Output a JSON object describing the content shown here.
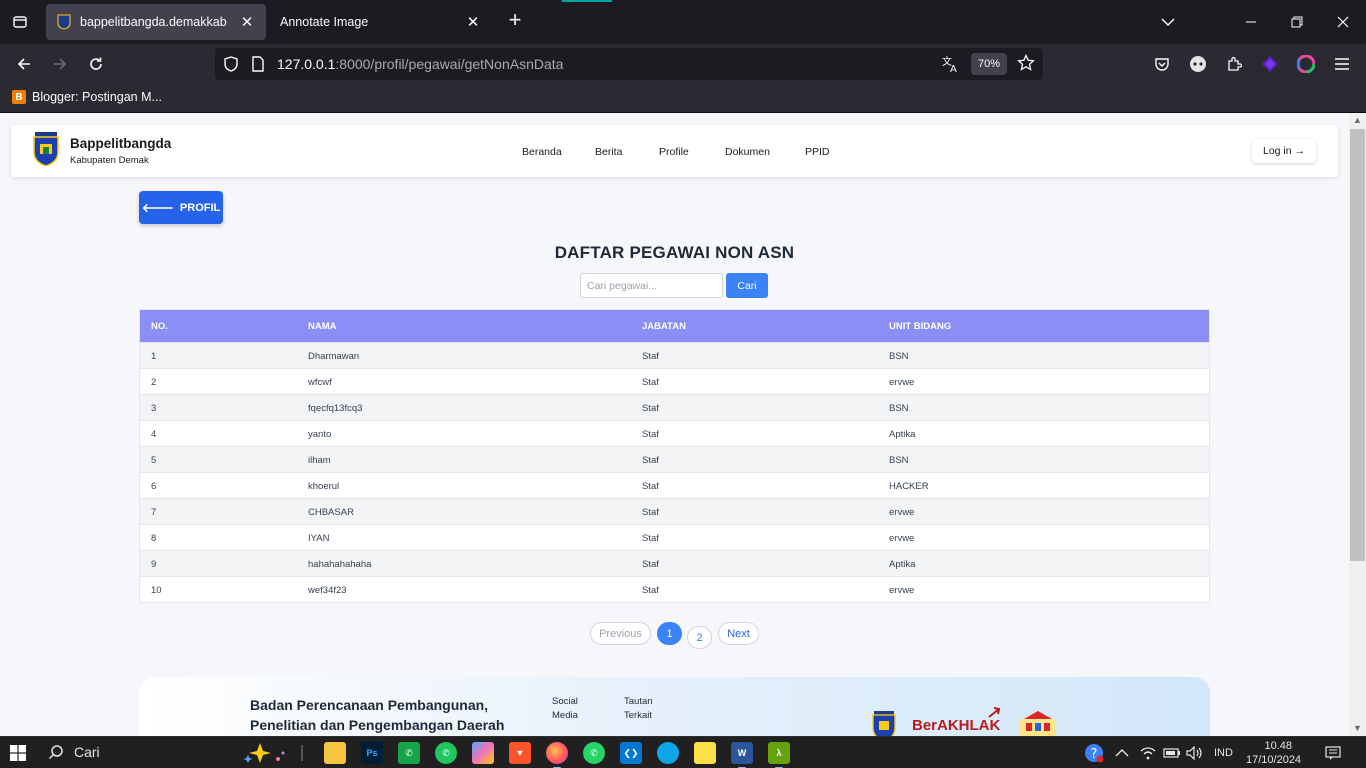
{
  "browser": {
    "tabs": [
      {
        "title": "bappelitbangda.demakkab",
        "active": true
      },
      {
        "title": "Annotate Image",
        "active": false
      }
    ],
    "url_host": "127.0.0.1",
    "url_rest": ":8000/profil/pegawai/getNonAsnData",
    "zoom": "70%",
    "bookmark": "Blogger: Postingan M..."
  },
  "site": {
    "brand_name": "Bappelitbangda",
    "brand_sub": "Kabupaten Demak",
    "menu": [
      "Beranda",
      "Berita",
      "Profile",
      "Dokumen",
      "PPID"
    ],
    "login": "Log in →"
  },
  "page": {
    "back_button": "PROFIL",
    "title": "DAFTAR PEGAWAI NON ASN",
    "search_placeholder": "Cari pegawai...",
    "search_button": "Cari"
  },
  "table": {
    "headers": [
      "NO.",
      "NAMA",
      "JABATAN",
      "UNIT BIDANG"
    ],
    "rows": [
      [
        "1",
        "Dharmawan",
        "Staf",
        "BSN"
      ],
      [
        "2",
        "wfcwf",
        "Staf",
        "ervwe"
      ],
      [
        "3",
        "fqecfq13fcq3",
        "Staf",
        "BSN"
      ],
      [
        "4",
        "yanto",
        "Staf",
        "Aptika"
      ],
      [
        "5",
        "ilham",
        "Staf",
        "BSN"
      ],
      [
        "6",
        "khoerul",
        "Staf",
        "HACKER"
      ],
      [
        "7",
        "CHBASAR",
        "Staf",
        "ervwe"
      ],
      [
        "8",
        "IYAN",
        "Staf",
        "ervwe"
      ],
      [
        "9",
        "hahahahahaha",
        "Staf",
        "Aptika"
      ],
      [
        "10",
        "wef34f23",
        "Staf",
        "ervwe"
      ]
    ]
  },
  "pagination": {
    "previous": "Previous",
    "pages": [
      "1",
      "2"
    ],
    "current": "1",
    "next": "Next"
  },
  "footer": {
    "org_line1": "Badan Perencanaan Pembangunan,",
    "org_line2": "Penelitian dan Pengembangan Daerah",
    "col1_line1": "Social",
    "col1_line2": "Media",
    "col2_line1": "Tautan",
    "col2_line2": "Terkait",
    "berakhlak": "BerAKHLAK"
  },
  "taskbar": {
    "search": "Cari",
    "lang": "IND",
    "time": "10.48",
    "date": "17/10/2024"
  },
  "colors": {
    "primary": "#2563eb",
    "table_header": "#8b8ef5",
    "browser_dark": "#1c1b22"
  }
}
